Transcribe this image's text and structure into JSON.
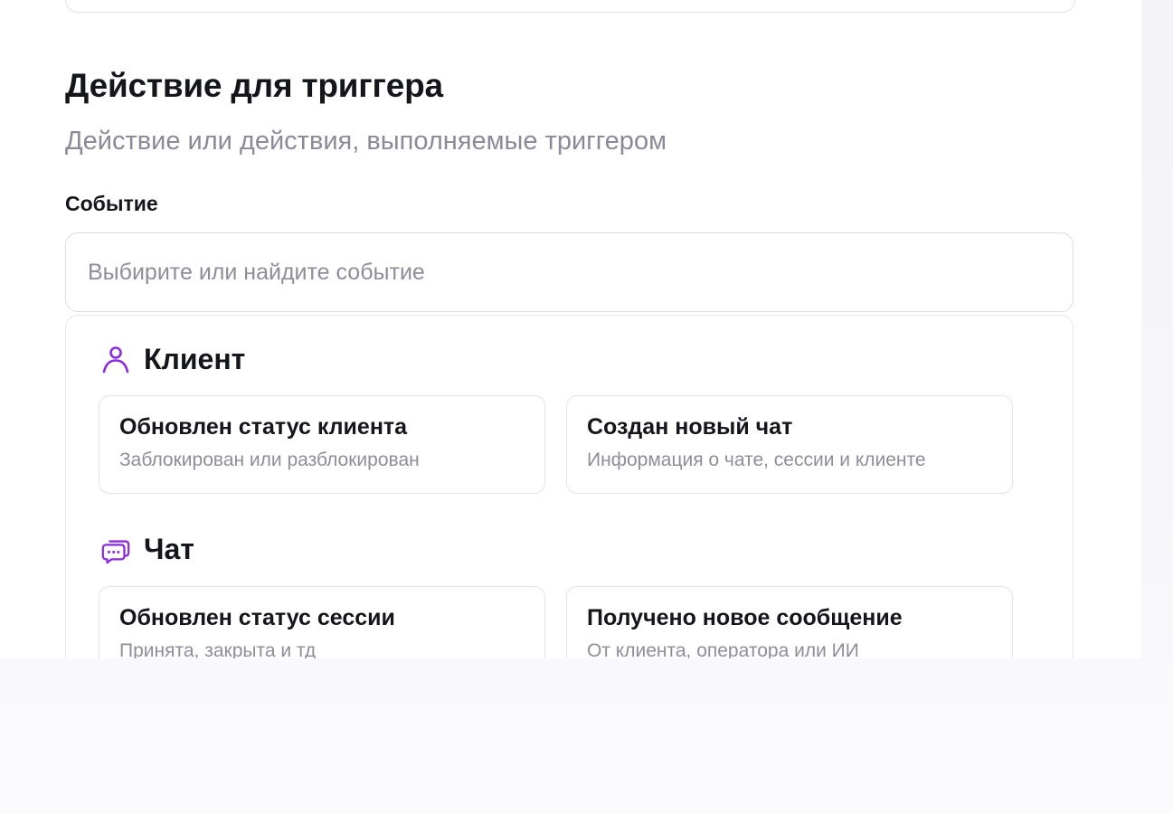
{
  "section": {
    "title": "Действие для триггера",
    "subtitle": "Действие или действия, выполняемые триггером"
  },
  "event_field": {
    "label": "Событие",
    "placeholder": "Выбирите или найдите событие",
    "value": ""
  },
  "groups": [
    {
      "title": "Клиент",
      "icon": "user-icon",
      "icon_color": "#8a2be2",
      "cards": [
        {
          "title": "Обновлен статус клиента",
          "description": "Заблокирован или разблокирован"
        },
        {
          "title": "Создан новый чат",
          "description": "Информация о чате, сессии и клиенте"
        }
      ]
    },
    {
      "title": "Чат",
      "icon": "chat-icon",
      "icon_color": "#8a2be2",
      "cards": [
        {
          "title": "Обновлен статус сессии",
          "description": "Принята, закрыта и тд"
        },
        {
          "title": "Получено новое сообщение",
          "description": "От клиента, оператора или ИИ"
        }
      ]
    }
  ]
}
